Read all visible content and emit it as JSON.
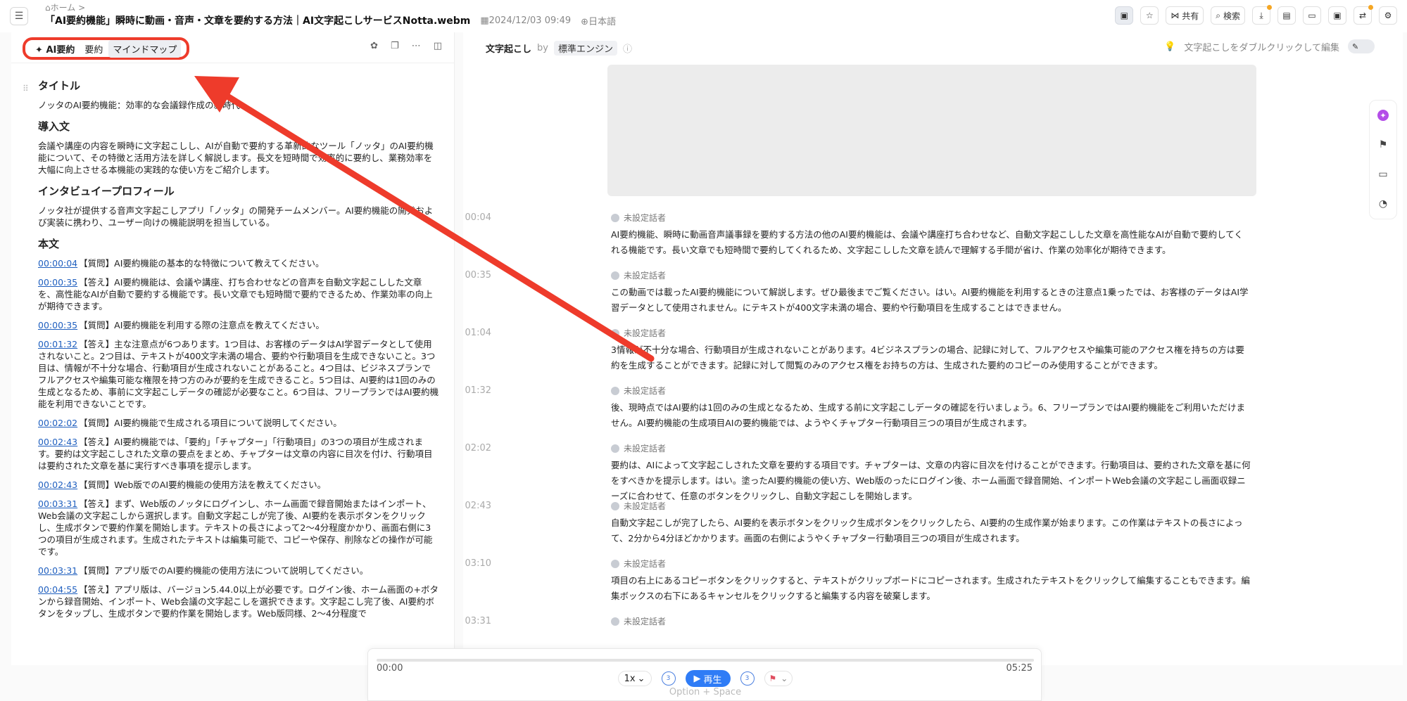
{
  "header": {
    "breadcrumb": "ホーム",
    "breadcrumb_sep": ">",
    "title": "「AI要約機能」瞬時に動画・音声・文章を要約する方法｜AI文字起こしサービスNotta.webm",
    "date": "2024/12/03 09:49",
    "language": "日本語",
    "share_label": "共有",
    "search_label": "検索"
  },
  "left": {
    "tabs": [
      {
        "label": "AI要約"
      },
      {
        "label": "要約"
      },
      {
        "label": "マインドマップ"
      }
    ],
    "sections": {
      "title_head": "タイトル",
      "title_text": "ノッタのAI要約機能：効率的な会議録作成の新時代",
      "intro_head": "導入文",
      "intro_text": "会議や講座の内容を瞬時に文字起こしし、AIが自動で要約する革新的なツール「ノッタ」のAI要約機能について、その特徴と活用方法を詳しく解説します。長文を短時間で効率的に要約し、業務効率を大幅に向上させる本機能の実践的な使い方をご紹介します。",
      "profile_head": "インタビュイープロフィール",
      "profile_text": "ノッタ社が提供する音声文字起こしアプリ「ノッタ」の開発チームメンバー。AI要約機能の開発および実装に携わり、ユーザー向けの機能説明を担当している。",
      "body_head": "本文"
    },
    "items": [
      {
        "ts": "00:00:04",
        "text": "【質問】AI要約機能の基本的な特徴について教えてください。"
      },
      {
        "ts": "00:00:35",
        "text": "【答え】AI要約機能は、会議や講座、打ち合わせなどの音声を自動文字起こしした文章を、高性能なAIが自動で要約する機能です。長い文章でも短時間で要約できるため、作業効率の向上が期待できます。"
      },
      {
        "ts": "00:00:35",
        "text": "【質問】AI要約機能を利用する際の注意点を教えてください。"
      },
      {
        "ts": "00:01:32",
        "text": "【答え】主な注意点が6つあります。1つ目は、お客様のデータはAI学習データとして使用されないこと。2つ目は、テキストが400文字未満の場合、要約や行動項目を生成できないこと。3つ目は、情報が不十分な場合、行動項目が生成されないことがあること。4つ目は、ビジネスプランでフルアクセスや編集可能な権限を持つ方のみが要約を生成できること。5つ目は、AI要約は1回のみの生成となるため、事前に文字起こしデータの確認が必要なこと。6つ目は、フリープランではAI要約機能を利用できないことです。"
      },
      {
        "ts": "00:02:02",
        "text": "【質問】AI要約機能で生成される項目について説明してください。"
      },
      {
        "ts": "00:02:43",
        "text": "【答え】AI要約機能では、「要約」「チャプター」「行動項目」の3つの項目が生成されます。要約は文字起こしされた文章の要点をまとめ、チャプターは文章の内容に目次を付け、行動項目は要約された文章を基に実行すべき事項を提示します。"
      },
      {
        "ts": "00:02:43",
        "text": "【質問】Web版でのAI要約機能の使用方法を教えてください。"
      },
      {
        "ts": "00:03:31",
        "text": "【答え】まず、Web版のノッタにログインし、ホーム画面で録音開始またはインポート、Web会議の文字起こしから選択します。自動文字起こしが完了後、AI要約を表示ボタンをクリックし、生成ボタンで要約作業を開始します。テキストの長さによって2〜4分程度かかり、画面右側に3つの項目が生成されます。生成されたテキストは編集可能で、コピーや保存、削除などの操作が可能です。"
      },
      {
        "ts": "00:03:31",
        "text": "【質問】アプリ版でのAI要約機能の使用方法について説明してください。"
      },
      {
        "ts": "00:04:55",
        "text": "【答え】アプリ版は、バージョン5.44.0以上が必要です。ログイン後、ホーム画面の+ボタンから録音開始、インポート、Web会議の文字起こしを選択できます。文字起こし完了後、AI要約ボタンをタップし、生成ボタンで要約作業を開始します。Web版同様、2〜4分程度で"
      }
    ]
  },
  "right": {
    "heading": "文字起こし",
    "by": "by",
    "engine": "標準エンジン",
    "hint": "文字起こしをダブルクリックして編集",
    "segments": [
      {
        "time": "00:04",
        "speaker": "未設定話者",
        "text": "AI要約機能、瞬時に動画音声議事録を要約する方法の他のAI要約機能は、会議や講座打ち合わせなど、自動文字起こしした文章を高性能なAIが自動で要約してくれる機能です。長い文章でも短時間で要約してくれるため、文字起こしした文章を読んで理解する手間が省け、作業の効率化が期待できます。"
      },
      {
        "time": "00:35",
        "speaker": "未設定話者",
        "text": "この動画では載ったAI要約機能について解説します。ぜひ最後までご覧ください。はい。AI要約機能を利用するときの注意点1乗ったでは、お客様のデータはAI学習データとして使用されません。にテキストが400文字未満の場合、要約や行動項目を生成することはできません。"
      },
      {
        "time": "01:04",
        "speaker": "未設定話者",
        "text": "3情報が不十分な場合、行動項目が生成されないことがあります。4ビジネスプランの場合、記録に対して、フルアクセスや編集可能のアクセス権を持ちの方は要約を生成することができます。記録に対して閲覧のみのアクセス権をお持ちの方は、生成された要約のコピーのみ使用することができます。"
      },
      {
        "time": "01:32",
        "speaker": "未設定話者",
        "text": "後、現時点ではAI要約は1回のみの生成となるため、生成する前に文字起こしデータの確認を行いましょう。6、フリープランではAI要約機能をご利用いただけません。AI要約機能の生成項目AIの要約機能では、ようやくチャプター行動項目三つの項目が生成されます。"
      },
      {
        "time": "02:02",
        "speaker": "未設定話者",
        "text": "要約は、AIによって文字起こしされた文章を要約する項目です。チャプターは、文章の内容に目次を付けることができます。行動項目は、要約された文章を基に何をすべきかを提示します。はい。塗ったAI要約機能の使い方、Web版のったにログイン後、ホーム画面で録音開始、インポートWeb会議の文字起こし画面収録ニーズに合わせて、任意のボタンをクリックし、自動文字起こしを開始します。"
      },
      {
        "time": "02:43",
        "speaker": "未設定話者",
        "text": "自動文字起こしが完了したら、AI要約を表示ボタンをクリック生成ボタンをクリックしたら、AI要約の生成作業が始まります。この作業はテキストの長さによって、2分から4分ほどかかります。画面の右側にようやくチャプター行動項目三つの項目が生成されます。"
      },
      {
        "time": "03:10",
        "speaker": "未設定話者",
        "text": "項目の右上にあるコピーボタンをクリックすると、テキストがクリップボードにコピーされます。生成されたテキストをクリックして編集することもできます。編集ボックスの右下にあるキャンセルをクリックすると編集する内容を破棄します。"
      },
      {
        "time": "03:31",
        "speaker": "未設定話者",
        "text": ""
      }
    ]
  },
  "player": {
    "current": "00:00",
    "total": "05:25",
    "progress": 0,
    "speed": "1x",
    "skip_back": "3",
    "skip_fwd": "3",
    "play_label": "再生",
    "shortcut_hint": "Option + Space"
  },
  "colors": {
    "accent": "#2f7cf6",
    "annotation": "#ee3b2b",
    "link": "#1f5fbf"
  }
}
